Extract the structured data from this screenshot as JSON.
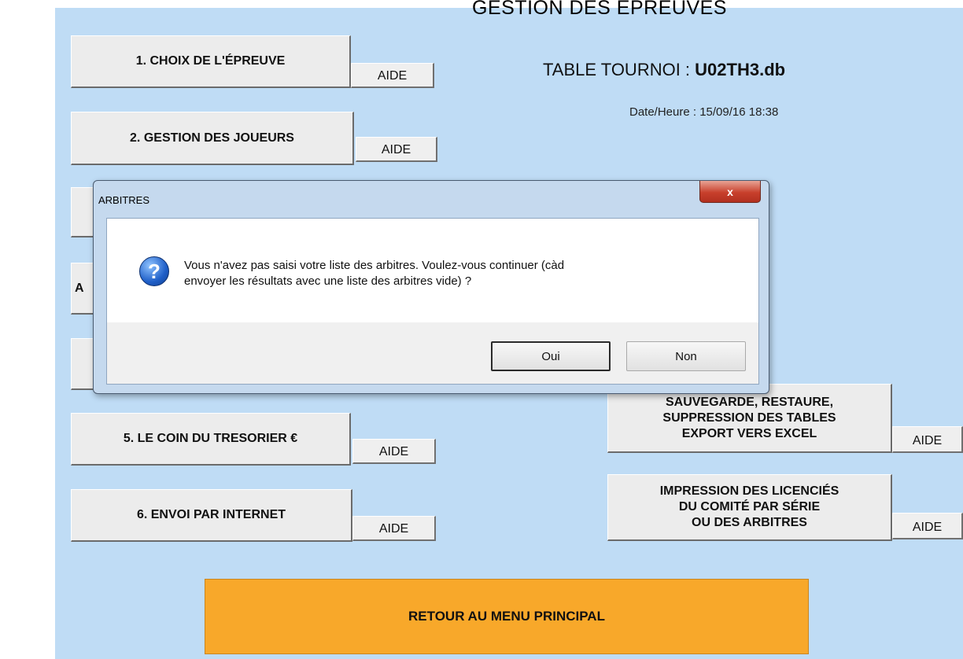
{
  "header": {
    "title": "GESTION DES ÉPREUVES",
    "table_label": "TABLE TOURNOI : ",
    "table_name": "U02TH3.db",
    "date_label": "Date/Heure : 15/09/16 18:38"
  },
  "buttons": {
    "choix": "1. CHOIX DE L'ÉPREUVE",
    "joueurs": "2. GESTION DES JOUEURS",
    "tresorier": "5. LE COIN DU TRESORIER  €",
    "envoi": "6. ENVOI PAR INTERNET",
    "retour": "RETOUR AU MENU PRINCIPAL",
    "sauvegarde": [
      "SAUVEGARDE, RESTAURE,",
      "SUPPRESSION DES TABLES",
      "EXPORT VERS EXCEL"
    ],
    "impression": [
      "IMPRESSION DES LICENCIÉS",
      "DU COMITÉ PAR SÉRIE",
      "OU DES ARBITRES"
    ],
    "aide": "AIDE",
    "partial_letter": "A"
  },
  "dialog": {
    "title": "ARBITRES",
    "close": "x",
    "message_line1": "Vous n'avez pas saisi votre liste des arbitres. Voulez-vous continuer (càd",
    "message_line2": "envoyer les résultats avec une liste des arbitres vide) ?",
    "yes": "Oui",
    "no": "Non",
    "icon": "question-icon"
  }
}
